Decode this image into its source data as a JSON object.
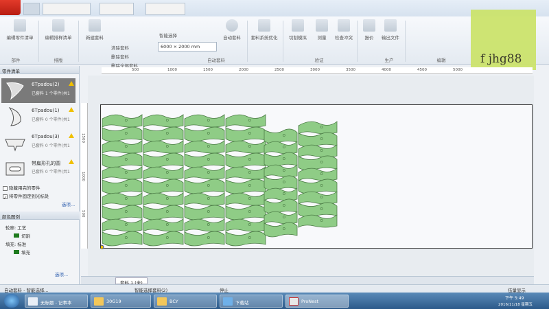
{
  "window": {
    "tabs": [
      "",
      "",
      "",
      ""
    ]
  },
  "ribbon": {
    "buttons": [
      {
        "label": "编辑零件清单"
      },
      {
        "label": "编辑排样清单"
      },
      {
        "label": "新建套料"
      },
      {
        "label": "自动套料"
      },
      {
        "label": "套料系统优化"
      },
      {
        "label": "切割模拟"
      },
      {
        "label": "测量"
      },
      {
        "label": "检查冲突"
      },
      {
        "label": "报价"
      },
      {
        "label": "输出文件"
      }
    ],
    "small_items": [
      "清除套料",
      "删除套料",
      "删除全部套料"
    ],
    "sheet_combo_label": "智能选择",
    "sheet_size": "6000 × 2000 mm",
    "groups": [
      "部件",
      "排版",
      "自动套料",
      "验证",
      "生产",
      "编辑"
    ]
  },
  "watermark": {
    "text": "f jhg88"
  },
  "left_panel": {
    "title": "零件清单",
    "parts": [
      {
        "name": "6Tpadou(2)",
        "status": "已套料 1 个零件(共1"
      },
      {
        "name": "6Tpadou(1)",
        "status": "已套料 0 个零件(共1"
      },
      {
        "name": "6Tpadou(3)",
        "status": "已套料 0 个零件(共1"
      },
      {
        "name": "带扁形孔的圆",
        "status": "已套料 0 个零件(共1"
      }
    ],
    "checkbox1": "隐藏用完的零件",
    "checkbox2": "将零件固定到光标处",
    "more_link": "选项...",
    "color_title": "颜色图例",
    "legend_group1": "轮廓: 工艺",
    "legend_item1": "切割",
    "legend_group2": "填充: 标准",
    "legend_item2": "填充",
    "more_link2": "选项..."
  },
  "ruler": {
    "h_ticks": [
      "500",
      "1000",
      "1500",
      "2000",
      "2500",
      "3000",
      "3500",
      "4000",
      "4500",
      "5000"
    ],
    "v_ticks": [
      "1500",
      "1000",
      "500"
    ]
  },
  "canvas": {
    "part_fill": "#8fcc86",
    "part_stroke": "#4a7a44",
    "sheet_border": "#333333"
  },
  "tabs": {
    "active": "套料 1 (未)"
  },
  "status": {
    "left": "自动套料 - 智能选择...",
    "middle": "智能选择套料(2)",
    "stop": "停止",
    "right": "伍量显示"
  },
  "taskbar": {
    "items": [
      "无标题 - 记事本",
      "30G19",
      "BCY",
      "下载站",
      "ProNest"
    ],
    "time": "下午 5:49",
    "date": "2016/11/18 星期五"
  }
}
